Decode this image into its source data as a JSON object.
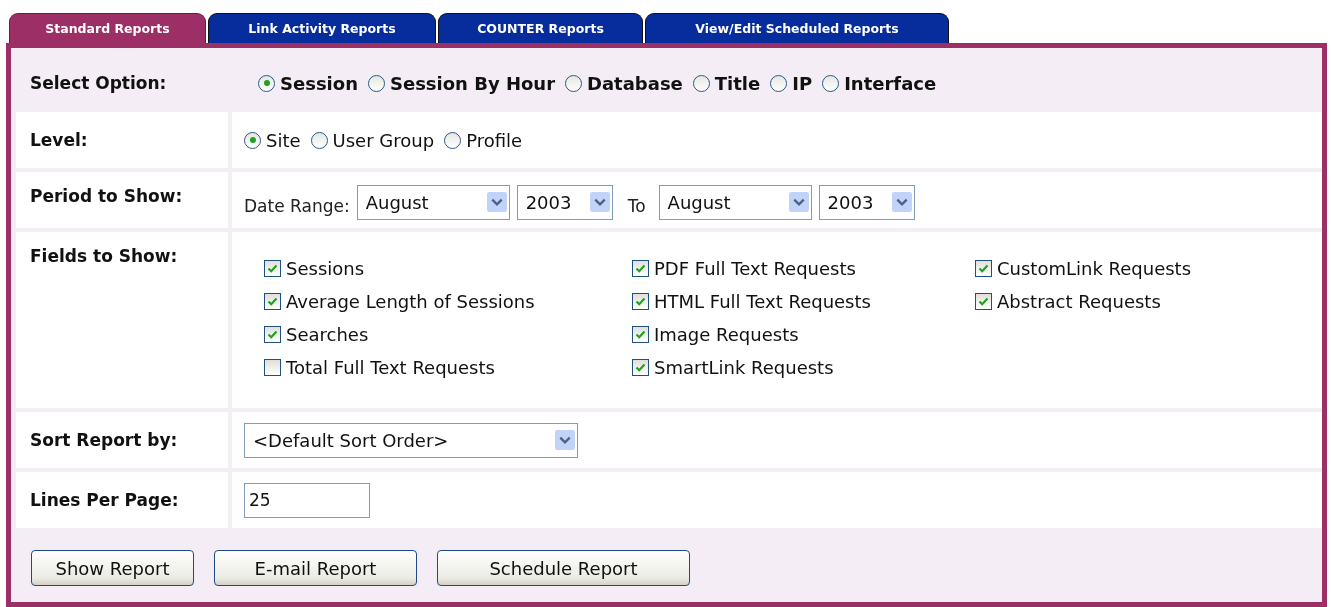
{
  "tabs": [
    {
      "label": "Standard Reports",
      "selected": true
    },
    {
      "label": "Link Activity Reports",
      "selected": false
    },
    {
      "label": "COUNTER Reports",
      "selected": false
    },
    {
      "label": "View/Edit Scheduled Reports",
      "selected": false
    }
  ],
  "select_option": {
    "label": "Select Option:",
    "options": [
      {
        "label": "Session",
        "selected": true
      },
      {
        "label": "Session By Hour",
        "selected": false
      },
      {
        "label": "Database",
        "selected": false
      },
      {
        "label": "Title",
        "selected": false
      },
      {
        "label": "IP",
        "selected": false
      },
      {
        "label": "Interface",
        "selected": false
      }
    ]
  },
  "level": {
    "label": "Level:",
    "options": [
      {
        "label": "Site",
        "selected": true
      },
      {
        "label": "User Group",
        "selected": false
      },
      {
        "label": "Profile",
        "selected": false
      }
    ]
  },
  "period": {
    "label": "Period to Show:",
    "range_label": "Date Range:",
    "from_month": "August",
    "from_year": "2003",
    "to_label": "To",
    "to_month": "August",
    "to_year": "2003"
  },
  "fields": {
    "label": "Fields to Show:",
    "columns": [
      [
        {
          "label": "Sessions",
          "checked": true
        },
        {
          "label": "Average Length of Sessions",
          "checked": true
        },
        {
          "label": "Searches",
          "checked": true
        },
        {
          "label": "Total Full Text Requests",
          "checked": false
        }
      ],
      [
        {
          "label": "PDF Full Text Requests",
          "checked": true
        },
        {
          "label": "HTML Full Text Requests",
          "checked": true
        },
        {
          "label": "Image Requests",
          "checked": true
        },
        {
          "label": "SmartLink Requests",
          "checked": true
        }
      ],
      [
        {
          "label": "CustomLink Requests",
          "checked": true
        },
        {
          "label": "Abstract Requests",
          "checked": true
        }
      ]
    ]
  },
  "sort": {
    "label": "Sort Report by:",
    "value": "<Default Sort Order>"
  },
  "lines": {
    "label": "Lines Per Page:",
    "value": "25"
  },
  "buttons": [
    "Show Report",
    "E-mail Report",
    "Schedule Report"
  ]
}
